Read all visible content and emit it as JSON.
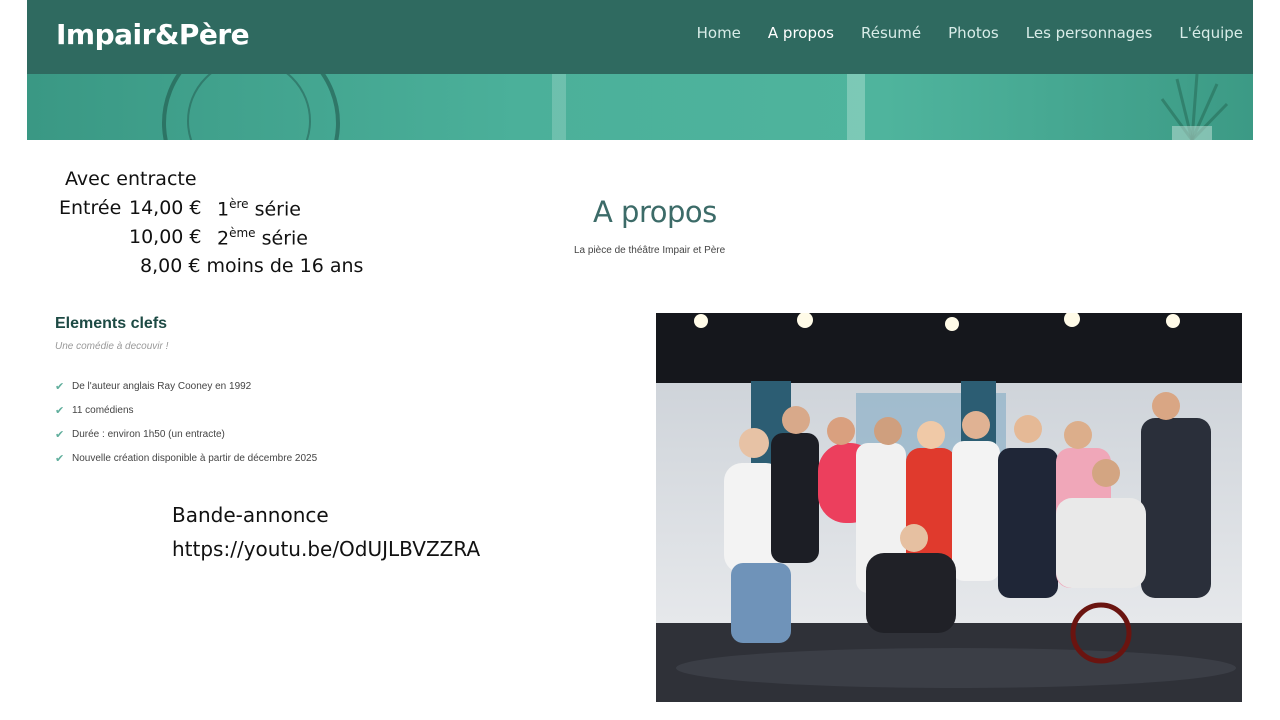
{
  "header": {
    "brand": "Impair&Père",
    "nav": [
      {
        "label": "Home",
        "active": false
      },
      {
        "label": "A propos",
        "active": true
      },
      {
        "label": "Résumé",
        "active": false
      },
      {
        "label": "Photos",
        "active": false
      },
      {
        "label": "Les personnages",
        "active": false
      },
      {
        "label": "L'équipe",
        "active": false
      }
    ]
  },
  "prices": {
    "intro": "Avec entracte",
    "entry_label": "Entrée",
    "tier1_price": "14,00 €",
    "tier1_num": "1",
    "tier1_sup": "ère",
    "tier1_suffix": "série",
    "tier2_price": "10,00 €",
    "tier2_num": "2",
    "tier2_sup": "ème",
    "tier2_suffix": "série",
    "tier3": "8,00 € moins de 16 ans"
  },
  "about": {
    "title": "A propos",
    "subtitle": "La pièce de théâtre Impair et Père"
  },
  "key_elements": {
    "title": "Elements clefs",
    "subtitle": "Une comédie à decouvir !",
    "items": [
      "De l'auteur anglais Ray Cooney en 1992",
      "11 comédiens",
      "Durée : environ 1h50 (un entracte)",
      "Nouvelle création disponible à partir de décembre 2025"
    ]
  },
  "trailer": {
    "label": "Bande-annonce",
    "url": "https://youtu.be/OdUJLBVZZRA"
  },
  "colors": {
    "header_bg": "#2f6a60",
    "banner": "#4bb09a",
    "title": "#3c6b68",
    "check": "#5fae9c"
  }
}
